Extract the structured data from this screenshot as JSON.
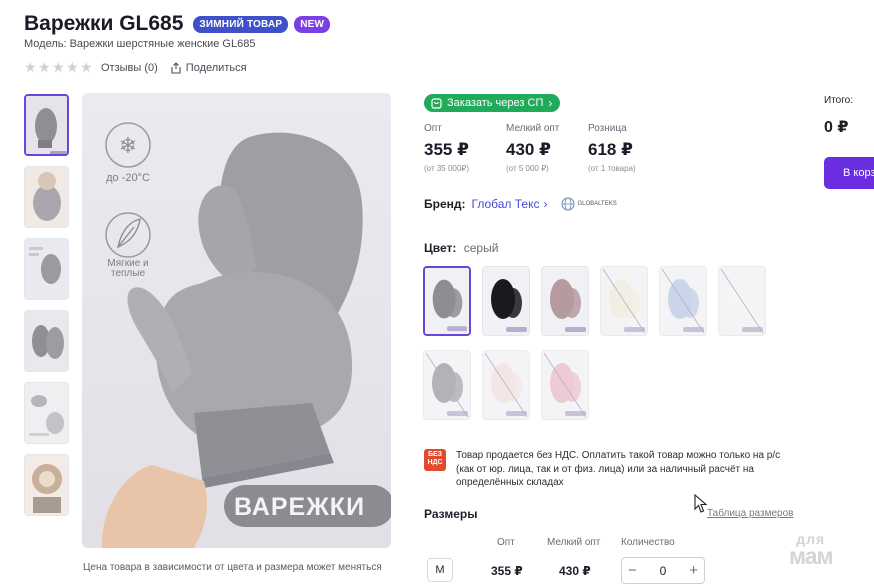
{
  "product": {
    "title": "Варежки GL685",
    "badges": [
      "ЗИМНИЙ ТОВАР",
      "NEW"
    ],
    "model": "Модель: Варежки шерстяные женские GL685",
    "reviews": "Отзывы (0)",
    "share": "Поделиться",
    "rating_stars": 0
  },
  "gallery": {
    "photo_text": {
      "temp": "до -20°С",
      "soft": "Мягкие и теплые",
      "banner": "ВАРЕЖКИ"
    },
    "thumbs_count": 6,
    "note": "Цена товара в зависимости от цвета и размера может меняться"
  },
  "order_sp": "Заказать через СП",
  "prices": [
    {
      "label": "Опт",
      "value": "355 ₽",
      "note": "(от 35 000₽)"
    },
    {
      "label": "Мелкий опт",
      "value": "430 ₽",
      "note": "(от 5 000 ₽)"
    },
    {
      "label": "Розница",
      "value": "618 ₽",
      "note": "(от 1 товара)"
    }
  ],
  "brand": {
    "label": "Бренд:",
    "name": "Глобал Текс",
    "logo_text": "GLOBALTEKS"
  },
  "color": {
    "label": "Цвет:",
    "value": "серый"
  },
  "swatches": [
    {
      "color": "#8d8d94",
      "available": true,
      "selected": true
    },
    {
      "color": "#1a1a1d",
      "available": true
    },
    {
      "color": "#b59aa0",
      "available": true
    },
    {
      "color": "#efe9dc",
      "available": false
    },
    {
      "color": "#b8c7e3",
      "available": false
    },
    {
      "color": "#f2f2f2",
      "available": false
    },
    {
      "color": "#9a9aa0",
      "available": false
    },
    {
      "color": "#f0dfdd",
      "available": false
    },
    {
      "color": "#e9b9c6",
      "available": false
    }
  ],
  "vat": {
    "icon": "БЕЗ НДС",
    "text": "Товар продается без НДС. Оплатить такой товар можно только на р/с (как от юр. лица, так и от физ. лица) или за наличный расчёт на определённых складах"
  },
  "sizes": {
    "title": "Размеры",
    "table_link": "Таблица размеров",
    "headers": [
      "Опт",
      "Мелкий опт",
      "Количество"
    ],
    "row": {
      "size": "M",
      "opt": "355 ₽",
      "small_opt": "430 ₽",
      "qty": "0"
    }
  },
  "summary": {
    "total_label": "Итого:",
    "total_value": "0 ₽",
    "cart": "В корз"
  },
  "watermark": {
    "line1": "для",
    "line2": "мам"
  },
  "colors": {
    "accent": "#6b44d9",
    "green": "#1fab5a",
    "badge_winter": "#3f51c9",
    "badge_new": "#7b3fe4"
  }
}
